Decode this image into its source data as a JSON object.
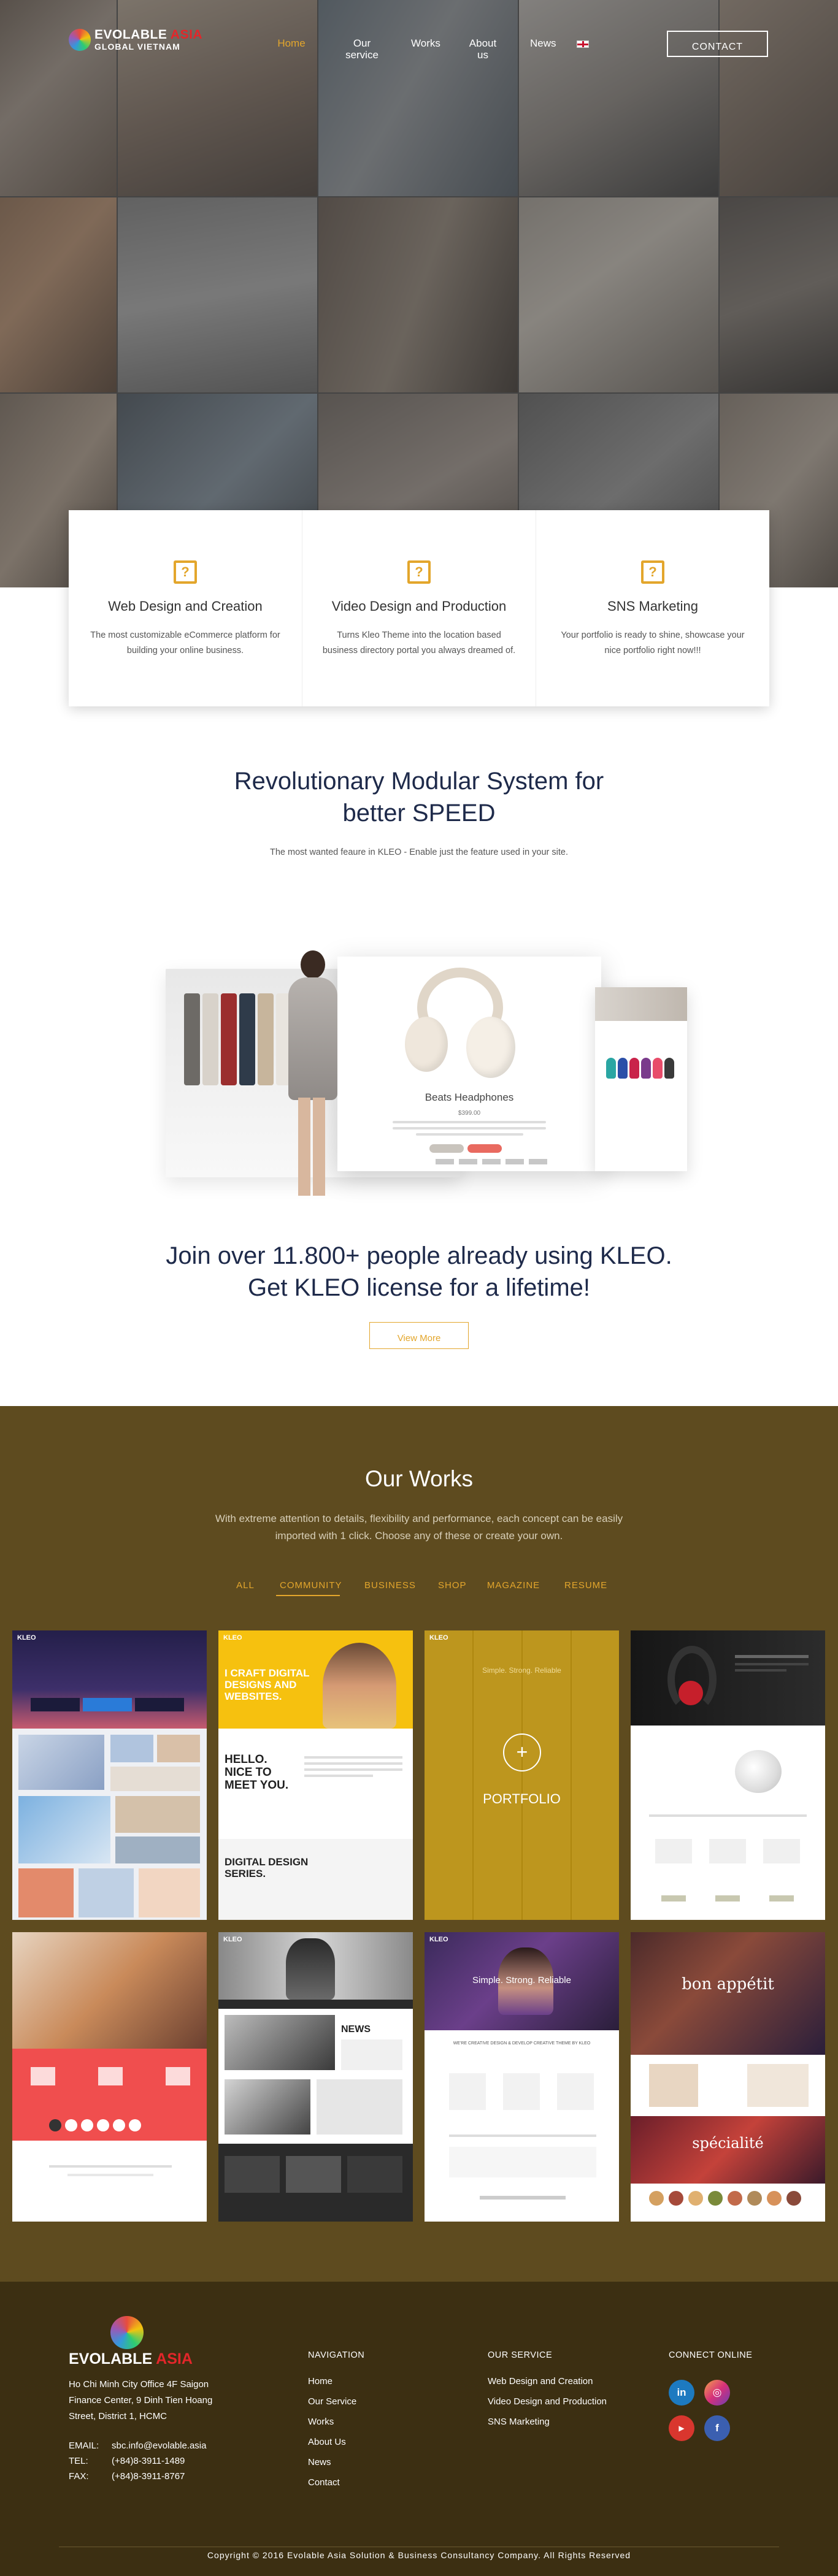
{
  "colors": {
    "accent": "#e3a62c",
    "brand_red": "#e3262a",
    "works_bg": "#5e4b1f",
    "footer_bg": "#3c2f12",
    "heading": "#1e2a4a"
  },
  "logo": {
    "brand": "EVOLABLE",
    "brand_accent": "ASIA",
    "sub": "GLOBAL VIETNAM"
  },
  "nav": {
    "items": [
      "Home",
      "Our service",
      "Works",
      "About us",
      "News"
    ],
    "language_icon": "uk-flag-icon",
    "contact": "CONTACT"
  },
  "features": [
    {
      "icon": "question-icon",
      "title": "Web Design and Creation",
      "text": "The most customizable eCommerce platform for building your online business."
    },
    {
      "icon": "question-icon",
      "title": "Video Design and Production",
      "text": "Turns Kleo Theme into the location based business directory portal you always dreamed of."
    },
    {
      "icon": "question-icon",
      "title": "SNS Marketing",
      "text": "Your portfolio is ready to shine, showcase your nice portfolio right now!!!"
    }
  ],
  "revolutionary": {
    "title_line1": "Revolutionary Modular System for",
    "title_line2": "better SPEED",
    "subtitle": "The most wanted feaure in KLEO - Enable just the feature used in your site."
  },
  "mockup": {
    "product_title": "Beats Headphones",
    "price": "$399.00"
  },
  "join": {
    "line1": "Join over 11.800+ people already using KLEO.",
    "line2": "Get KLEO license for a lifetime!",
    "button": "View More"
  },
  "works": {
    "title": "Our Works",
    "description": "With extreme attention to details, flexibility and performance, each concept can be easily imported with 1 click. Choose any of these or create your own.",
    "filters": [
      "ALL",
      "COMMUNITY",
      "BUSINESS",
      "SHOP",
      "MAGAZINE",
      "RESUME"
    ],
    "active_filter": "COMMUNITY",
    "cards": [
      {
        "name": "community",
        "label": "KLEO"
      },
      {
        "name": "resume",
        "label": "KLEO",
        "headline1": "I CRAFT DIGITAL DESIGNS AND WEBSITES.",
        "headline2": "HELLO. NICE TO MEET YOU.",
        "headline3": "DIGITAL DESIGN SERIES."
      },
      {
        "name": "portfolio",
        "label": "KLEO",
        "headline": "Simple. Strong. Reliable",
        "overlay": "PORTFOLIO"
      },
      {
        "name": "shop",
        "label": ""
      },
      {
        "name": "education",
        "label": ""
      },
      {
        "name": "magazine",
        "label": "KLEO",
        "headline": "NEWS"
      },
      {
        "name": "business",
        "label": "KLEO",
        "headline": "Simple. Strong. Reliable",
        "subline": "WE'RE CREATIVE DESIGN & DEVELOP CREATIVE THEME BY KLEO"
      },
      {
        "name": "restaurant",
        "label": "",
        "headline1": "bon appétit",
        "headline2": "spécialité"
      }
    ]
  },
  "footer": {
    "logo_brand": "EVOLABLE",
    "logo_accent": "ASIA",
    "address": "Ho Chi Minh City Office 4F Saigon Finance Center, 9 Dinh Tien Hoang Street, District 1, HCMC",
    "email_label": "EMAIL:",
    "email": "sbc.info@evolable.asia",
    "tel_label": "TEL:",
    "tel": "(+84)8-3911-1489",
    "fax_label": "FAX:",
    "fax": "(+84)8-3911-8767",
    "navigation_title": "NAVIGATION",
    "navigation": [
      "Home",
      "Our Service",
      "Works",
      "About Us",
      "News",
      "Contact"
    ],
    "service_title": "OUR SERVICE",
    "services": [
      "Web Design and Creation",
      "Video Design and Production",
      "SNS Marketing"
    ],
    "connect_title": "CONNECT ONLINE",
    "social": [
      "linkedin-icon",
      "instagram-icon",
      "youtube-icon",
      "facebook-icon"
    ],
    "copyright": "Copyright © 2016 Evolable Asia Solution & Business Consultancy Company. All Rights Reserved"
  }
}
